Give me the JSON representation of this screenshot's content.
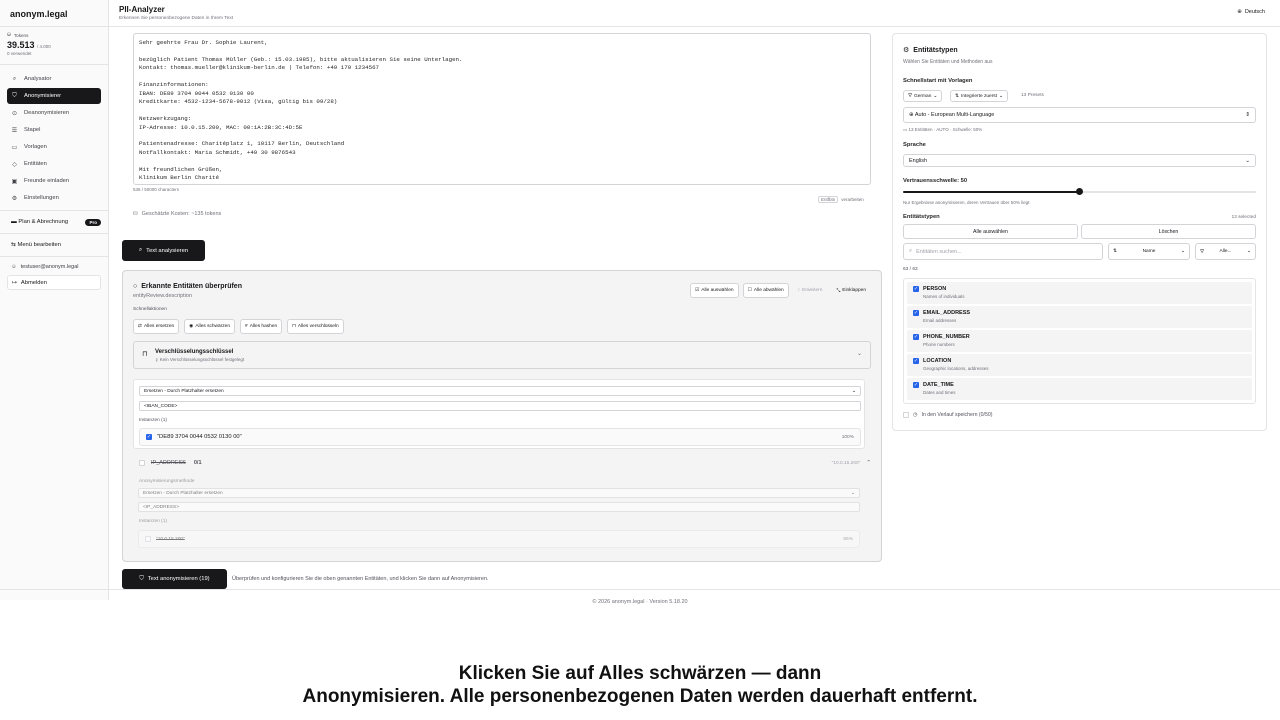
{
  "app": {
    "brand": "anonym.legal",
    "title": "PII-Analyzer",
    "subtitle": "Erkennen Sie personenbezogene Daten in Ihrem Text",
    "language": "Deutsch"
  },
  "tokens": {
    "label": "Tokens",
    "value": "39.513",
    "max": "/ 4.000",
    "used": "0 verwendet"
  },
  "sidebar": {
    "items": [
      {
        "label": "Analysator",
        "icon": "search-icon"
      },
      {
        "label": "Anonymisierer",
        "icon": "shield-icon"
      },
      {
        "label": "Deanonymisieren",
        "icon": "unlock-icon"
      },
      {
        "label": "Stapel",
        "icon": "layers-icon"
      },
      {
        "label": "Vorlagen",
        "icon": "document-icon"
      },
      {
        "label": "Entitäten",
        "icon": "tag-icon"
      },
      {
        "label": "Freunde einladen",
        "icon": "gift-icon"
      },
      {
        "label": "Einstellungen",
        "icon": "gear-icon"
      }
    ],
    "plan": "Plan & Abrechnung",
    "plan_badge": "Pro",
    "edit_menu": "Menü bearbeiten",
    "user_email": "testuser@anonym.legal",
    "logout": "Abmelden"
  },
  "editor": {
    "text": "Sehr geehrte Frau Dr. Sophie Laurent,\n\nbezüglich Patient Thomas Müller (Geb.: 15.03.1985), bitte aktualisieren Sie seine Unterlagen.\nKontakt: thomas.mueller@klinikum-berlin.de | Telefon: +49 170 1234567\n\nFinanzinformationen:\nIBAN: DE89 3704 0044 0532 0130 00\nKreditkarte: 4532-1234-5678-9012 (Visa, gültig bis 09/28)\n\nNetzwerkzugang:\nIP-Adresse: 10.0.15.200, MAC: 00:1A:2B:3C:4D:5E\n\nPatientenadresse: Charitéplatz 1, 10117 Berlin, Deutschland\nNotfallkontakt: Maria Schmidt, +49 30 9876543\n\nMit freundlichen Grüßen,\nKlinikum Berlin Charité",
    "char_count": "536 / 50000 characters",
    "unbind_key": "Entfbtn",
    "unbind_label": "verarbeiten",
    "cost": "Geschätzte Kosten: ~135 tokens",
    "analyze_button": "Text analysieren"
  },
  "review": {
    "title": "Erkannte Entitäten überprüfen",
    "description": "entityReview.description",
    "actions": {
      "select_all": "Alle auswählen",
      "deselect_all": "Alle abwählen",
      "expand": "Erweitern",
      "collapse": "Einklappen"
    },
    "quick_label": "Schnellaktionen",
    "quick": {
      "replace": "Alles ersetzen",
      "redact": "Alles schwärzen",
      "hash": "Alles hashen",
      "encrypt": "Alles verschlüsseln"
    },
    "encryption": {
      "title": "Verschlüsselungsschlüssel",
      "subtitle": "Kein Verschlüsselungsschlüssel festgelegt"
    },
    "iban": {
      "method": "Ersetzen - Durch Platzhalter ersetzen",
      "placeholder": "<IBAN_CODE>",
      "instances_label": "Instanzen (1)",
      "instance_text": "\"DE89 3704 0044 0532 0130 00\"",
      "instance_score": "100%"
    },
    "ip": {
      "name": "IP_ADDRESS",
      "count": "0/1",
      "preview": "\"10.0.15.200\"",
      "method_label": "Anonymisierungsmethode",
      "method": "Ersetzen - Durch Platzhalter ersetzen",
      "placeholder": "<IP_ADDRESS>",
      "instances_label": "Instanzen (1)",
      "instance_text": "\"10.0.15.200\"",
      "instance_score": "85%"
    }
  },
  "bottom": {
    "anonymize_button": "Text anonymisieren (19)",
    "hint": "Überprüfen und konfigurieren Sie die oben genannten Entitäten, und klicken Sie dann auf Anonymisieren.",
    "footer": "© 2026 anonym.legal · Version 5.18.20"
  },
  "right_panel": {
    "title": "Entitätstypen",
    "subtitle": "Wählen Sie Entitäten und Methoden aus",
    "quickstart_label": "Schnellstart mit Vorlagen",
    "filter_lang": "German",
    "filter_sort": "Integrierte zuerst",
    "presets": "13 Presets",
    "template": "Auto - European Multi-Language",
    "template_meta": "13 Entitäten · AUTO · Schwelle: 50%",
    "language_label": "Sprache",
    "language_value": "English",
    "threshold_label": "Vertrauensschwelle: 50",
    "threshold_value": 50,
    "threshold_hint": "Nur Ergebnisse anonymisieren, deren Vertrauen über 50% liegt",
    "types_label": "Entitätstypen",
    "selected": "13 selected",
    "select_all": "Alle auswählen",
    "clear": "Löschen",
    "search_placeholder": "Entitäten suchen...",
    "sort_value": "Name",
    "filter_value": "Alle...",
    "count": "63 / 63",
    "entities": [
      {
        "name": "PERSON",
        "desc": "Names of individuals"
      },
      {
        "name": "EMAIL_ADDRESS",
        "desc": "Email addresses"
      },
      {
        "name": "PHONE_NUMBER",
        "desc": "Phone numbers"
      },
      {
        "name": "LOCATION",
        "desc": "Geographic locations, addresses"
      },
      {
        "name": "DATE_TIME",
        "desc": "Dates and times"
      }
    ],
    "history": "In den Verlauf speichern (0/50)"
  },
  "caption": {
    "line1": "Klicken Sie auf Alles schwärzen — dann",
    "line2": "Anonymisieren. Alle personenbezogenen Daten werden dauerhaft entfernt."
  }
}
